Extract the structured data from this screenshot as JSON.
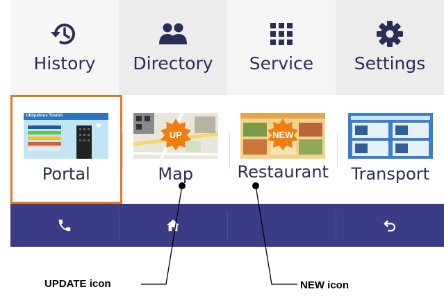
{
  "nav": {
    "tabs": [
      {
        "label": "History",
        "icon": "history-icon"
      },
      {
        "label": "Directory",
        "icon": "people-icon"
      },
      {
        "label": "Service",
        "icon": "grid-icon"
      },
      {
        "label": "Settings",
        "icon": "gear-icon"
      }
    ]
  },
  "tiles": [
    {
      "label": "Portal",
      "selected": true,
      "banner": "Ubiquitous Tourist"
    },
    {
      "label": "Map",
      "badge": "UP"
    },
    {
      "label": "Restaurant",
      "badge": "NEW"
    },
    {
      "label": "Transport"
    }
  ],
  "toolbar": {
    "items": [
      {
        "icon": "phone-icon"
      },
      {
        "icon": "home-icon"
      },
      {
        "icon": "blank"
      },
      {
        "icon": "back-icon"
      }
    ]
  },
  "annotations": {
    "update": "UPDATE icon",
    "new": "NEW icon"
  },
  "colors": {
    "nav_bg": "#ececec",
    "nav_text": "#2a2d55",
    "selected_border": "#e07a22",
    "toolbar_bg": "#3c3c86",
    "badge": "#f07d10"
  }
}
